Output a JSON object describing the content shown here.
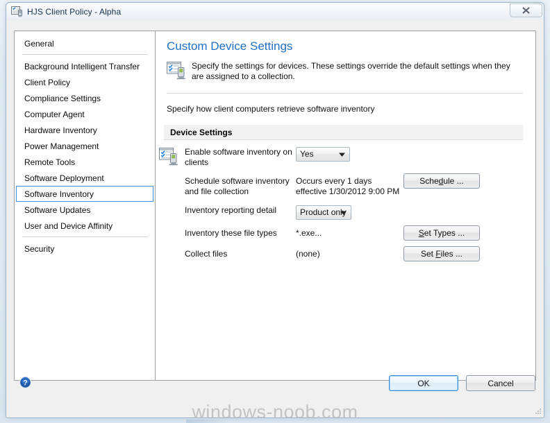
{
  "window": {
    "title": "HJS Client Policy - Alpha",
    "title_icon": "client-policy-icon",
    "close_label": "✕"
  },
  "sidebar": {
    "top_items": [
      {
        "label": "General"
      }
    ],
    "items": [
      {
        "label": "Background Intelligent Transfer"
      },
      {
        "label": "Client Policy"
      },
      {
        "label": "Compliance Settings"
      },
      {
        "label": "Computer Agent"
      },
      {
        "label": "Hardware Inventory"
      },
      {
        "label": "Power Management"
      },
      {
        "label": "Remote Tools"
      },
      {
        "label": "Software Deployment"
      },
      {
        "label": "Software Inventory"
      },
      {
        "label": "Software Updates"
      },
      {
        "label": "User and Device Affinity"
      }
    ],
    "selected": "Software Inventory",
    "bottom_items": [
      {
        "label": "Security"
      }
    ]
  },
  "main": {
    "title": "Custom Device Settings",
    "description": "Specify the settings for devices. These settings override the default settings when they are assigned to a collection.",
    "subtitle": "Specify how client computers retrieve software inventory",
    "section": {
      "label": "Device Settings",
      "rows": [
        {
          "label": "Enable software inventory on clients",
          "control": "combo",
          "value": "Yes"
        },
        {
          "label": "Schedule software inventory and file collection",
          "control": "text",
          "value": "Occurs every 1 days effective 1/30/2012 9:00 PM",
          "button": "Schedule ...",
          "button_accel": "d"
        },
        {
          "label": "Inventory reporting detail",
          "control": "combo",
          "value": "Product only"
        },
        {
          "label": "Inventory these file types",
          "control": "text",
          "value": "*.exe...",
          "button": "Set Types ...",
          "button_accel": "S"
        },
        {
          "label": "Collect files",
          "control": "text",
          "value": "(none)",
          "button": "Set Files ...",
          "button_accel": "F"
        }
      ]
    }
  },
  "footer": {
    "help_icon": "help-icon",
    "ok_label": "OK",
    "cancel_label": "Cancel"
  },
  "watermark": {
    "text": "windows-noob.com"
  },
  "colors": {
    "title_blue": "#1f6fc4",
    "focus_blue": "#3c8ddc",
    "band_gray": "#f2f2f2"
  }
}
